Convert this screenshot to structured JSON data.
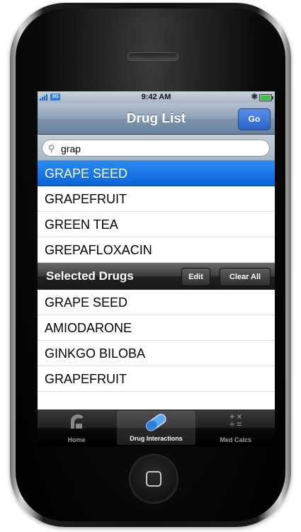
{
  "status_bar": {
    "time": "9:42 AM",
    "network": "3G"
  },
  "nav": {
    "title": "Drug List",
    "go_label": "Go"
  },
  "search": {
    "value": "grap"
  },
  "results": [
    {
      "label": "GRAPE SEED",
      "selected": true
    },
    {
      "label": "GRAPEFRUIT",
      "selected": false
    },
    {
      "label": "GREEN TEA",
      "selected": false
    },
    {
      "label": "GREPAFLOXACIN",
      "selected": false
    }
  ],
  "selected_section": {
    "label": "Selected Drugs",
    "edit_label": "Edit",
    "clear_label": "Clear All"
  },
  "selected_drugs": [
    "GRAPE SEED",
    "AMIODARONE",
    "GINKGO BILOBA",
    "GRAPEFRUIT"
  ],
  "tabs": [
    {
      "label": "Home",
      "icon": "home-icon",
      "active": false
    },
    {
      "label": "Drug Interactions",
      "icon": "pill-capsule-icon",
      "active": true
    },
    {
      "label": "Med Calcs",
      "icon": "calculator-icon",
      "active": false
    }
  ],
  "colors": {
    "selection_blue": "#0c63d7",
    "nav_blue": "#6c84a0"
  }
}
